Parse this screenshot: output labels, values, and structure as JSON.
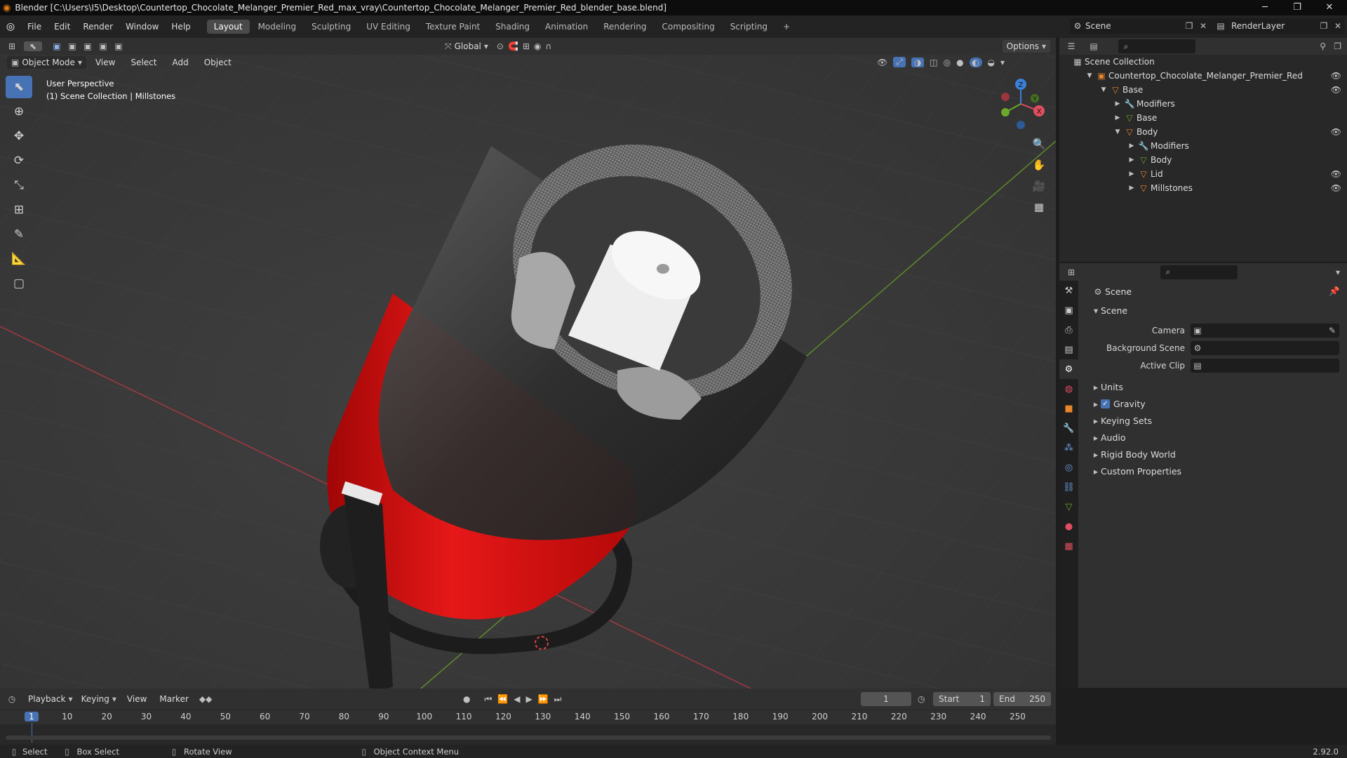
{
  "window": {
    "title": "Blender [C:\\Users\\I5\\Desktop\\Countertop_Chocolate_Melanger_Premier_Red_max_vray\\Countertop_Chocolate_Melanger_Premier_Red_blender_base.blend]",
    "minimize": "─",
    "maximize": "❐",
    "close": "✕"
  },
  "menu": {
    "items": [
      "File",
      "Edit",
      "Render",
      "Window",
      "Help"
    ]
  },
  "workspaces": {
    "tabs": [
      "Layout",
      "Modeling",
      "Sculpting",
      "UV Editing",
      "Texture Paint",
      "Shading",
      "Animation",
      "Rendering",
      "Compositing",
      "Scripting"
    ],
    "active": "Layout",
    "add": "+"
  },
  "scene_selector": {
    "label": "Scene"
  },
  "viewlayer_selector": {
    "label": "RenderLayer"
  },
  "viewport_header": {
    "transform_orientation": "Global",
    "options": "Options",
    "mode": "Object Mode",
    "menus": [
      "View",
      "Select",
      "Add",
      "Object"
    ]
  },
  "viewport": {
    "perspective": "User Perspective",
    "collection_info": "(1) Scene Collection | Millstones",
    "axis_x": "X",
    "axis_y": "Y",
    "axis_z": "Z"
  },
  "outliner": {
    "root": "Scene Collection",
    "rows": [
      {
        "label": "Countertop_Chocolate_Melanger_Premier_Red",
        "indent": 1,
        "icon": "collection-icon",
        "eye": true
      },
      {
        "label": "Base",
        "indent": 2,
        "icon": "object-icon",
        "eye": true
      },
      {
        "label": "Modifiers",
        "indent": 3,
        "icon": "wrench-icon",
        "eye": false
      },
      {
        "label": "Base",
        "indent": 3,
        "icon": "mesh-icon",
        "eye": false
      },
      {
        "label": "Body",
        "indent": 3,
        "icon": "object-icon",
        "eye": true
      },
      {
        "label": "Modifiers",
        "indent": 4,
        "icon": "wrench-icon",
        "eye": false
      },
      {
        "label": "Body",
        "indent": 4,
        "icon": "mesh-icon",
        "eye": false
      },
      {
        "label": "Lid",
        "indent": 4,
        "icon": "object-icon",
        "eye": true
      },
      {
        "label": "Millstones",
        "indent": 4,
        "icon": "object-icon",
        "eye": true
      }
    ]
  },
  "properties": {
    "context": "Scene",
    "panel": "Scene",
    "fields": [
      {
        "label": "Camera"
      },
      {
        "label": "Background Scene"
      },
      {
        "label": "Active Clip"
      }
    ],
    "sections": [
      "Units",
      "Gravity",
      "Keying Sets",
      "Audio",
      "Rigid Body World",
      "Custom Properties"
    ],
    "gravity_checked": true
  },
  "timeline": {
    "menus": [
      "Playback",
      "Keying",
      "View",
      "Marker"
    ],
    "current_frame": "1",
    "start_label": "Start",
    "start": "1",
    "end_label": "End",
    "end": "250",
    "ticks": [
      "1",
      "10",
      "20",
      "30",
      "40",
      "50",
      "60",
      "70",
      "80",
      "90",
      "100",
      "110",
      "120",
      "130",
      "140",
      "150",
      "160",
      "170",
      "180",
      "190",
      "200",
      "210",
      "220",
      "230",
      "240",
      "250"
    ]
  },
  "statusbar": {
    "select": "Select",
    "box_select": "Box Select",
    "rotate_view": "Rotate View",
    "context_menu": "Object Context Menu",
    "version": "2.92.0"
  },
  "colors": {
    "accent": "#4772b3",
    "body_red": "#e01414",
    "x_axis": "#e04f5f",
    "y_axis": "#6ba82c",
    "z_axis": "#3c7fd6"
  }
}
